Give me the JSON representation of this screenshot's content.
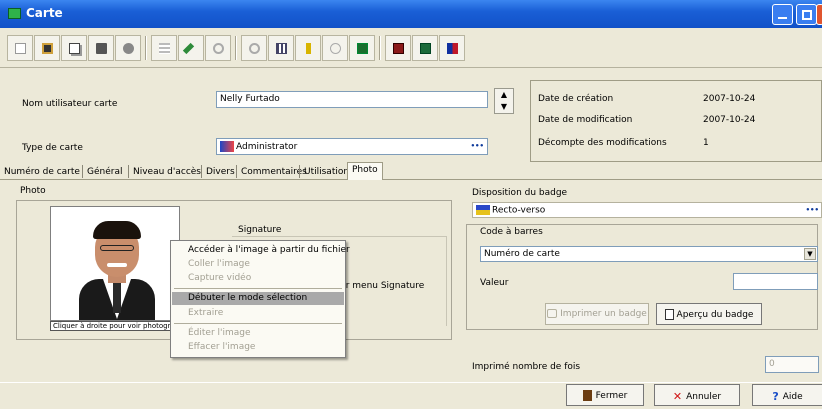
{
  "window": {
    "title": "Carte"
  },
  "colors": {
    "titlebar": "#1a5fd6",
    "accent": "#316ac5",
    "menu_highlight": "#a9a9a9"
  },
  "toolbar": {
    "icons": [
      "new-icon",
      "save-icon",
      "copy-icon",
      "delete-icon",
      "print-icon",
      "list-icon",
      "edit-icon",
      "find-icon",
      "search-icon",
      "grid-icon",
      "key-icon",
      "globe-icon",
      "table-icon",
      "card-icon",
      "export-icon",
      "flag-icon"
    ]
  },
  "header": {
    "user_label": "Nom utilisateur carte",
    "user_value": "Nelly Furtado",
    "type_label": "Type de carte",
    "type_value": "Administrator",
    "more_glyph": "•••"
  },
  "info": {
    "created_label": "Date de création",
    "created_value": "2007-10-24",
    "modified_label": "Date de modification",
    "modified_value": "2007-10-24",
    "count_label": "Décompte des modifications",
    "count_value": "1"
  },
  "tabs": [
    "Numéro de carte",
    "Général",
    "Niveau d'accès",
    "Divers",
    "Commentaires",
    "Utilisation",
    "Photo"
  ],
  "photo": {
    "label": "Photo",
    "caption": "Cliquer à droite pour voir photographie",
    "signature_label": "Signature",
    "signature_hint": "ur menu Signature"
  },
  "context_menu": {
    "items": [
      {
        "label": "Accéder à l'image à partir du fichier",
        "state": "enabled"
      },
      {
        "label": "Coller l'image",
        "state": "disabled"
      },
      {
        "label": "Capture vidéo",
        "state": "disabled"
      },
      {
        "label": "Débuter le mode sélection",
        "state": "selected"
      },
      {
        "label": "Extraire",
        "state": "disabled"
      },
      {
        "label": "Éditer l'image",
        "state": "disabled"
      },
      {
        "label": "Effacer l'image",
        "state": "disabled"
      }
    ]
  },
  "badge": {
    "layout_label": "Disposition du badge",
    "layout_value": "Recto-verso",
    "barcode_group": "Code à barres",
    "barcode_type": "Numéro de carte",
    "value_label": "Valeur",
    "value": "",
    "print_button": "Imprimer un badge",
    "preview_button": "Aperçu du badge",
    "printed_label": "Imprimé nombre de fois",
    "printed_value": "0"
  },
  "footer": {
    "close_button": "Fermer",
    "cancel_button": "Annuler",
    "help_button": "Aide"
  }
}
